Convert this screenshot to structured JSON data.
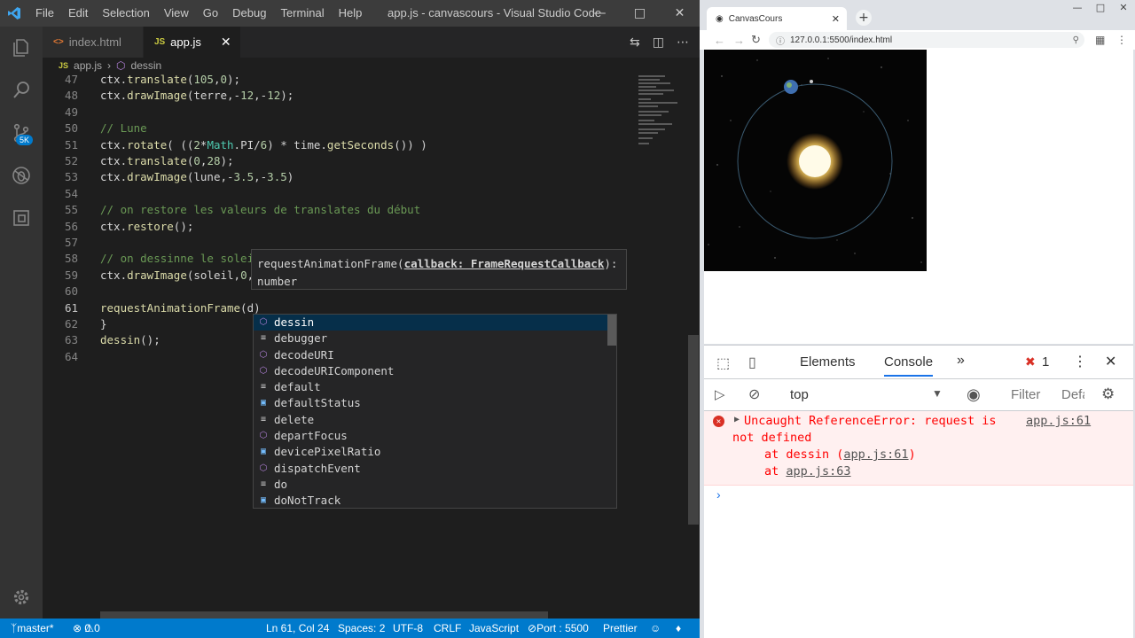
{
  "vscode": {
    "menu": [
      "File",
      "Edit",
      "Selection",
      "View",
      "Go",
      "Debug",
      "Terminal",
      "Help"
    ],
    "window_title": "app.js - canvascours - Visual Studio Code",
    "tabs": [
      {
        "label": "index.html",
        "icon": "<>"
      },
      {
        "label": "app.js",
        "icon": "JS"
      }
    ],
    "breadcrumb": {
      "file": "app.js",
      "symbol": "dessin"
    },
    "activity_badge": "5K",
    "hint": {
      "sig_name": "requestAnimationFrame(",
      "param": "callback: FrameRequestCallback",
      "sig_end": "):",
      "return_type": "number"
    },
    "suggestions": [
      {
        "label": "dessin",
        "kind": "cube"
      },
      {
        "label": "debugger",
        "kind": "kw"
      },
      {
        "label": "decodeURI",
        "kind": "cube"
      },
      {
        "label": "decodeURIComponent",
        "kind": "cube"
      },
      {
        "label": "default",
        "kind": "kw"
      },
      {
        "label": "defaultStatus",
        "kind": "var"
      },
      {
        "label": "delete",
        "kind": "kw"
      },
      {
        "label": "departFocus",
        "kind": "cube"
      },
      {
        "label": "devicePixelRatio",
        "kind": "var"
      },
      {
        "label": "dispatchEvent",
        "kind": "cube"
      },
      {
        "label": "do",
        "kind": "kw"
      },
      {
        "label": "doNotTrack",
        "kind": "var"
      }
    ],
    "status": {
      "branch": "master*",
      "errors": "0",
      "warnings": "0",
      "position": "Ln 61, Col 24",
      "spaces": "Spaces: 2",
      "encoding": "UTF-8",
      "eol": "CRLF",
      "language": "JavaScript",
      "port": "Port : 5500",
      "formatter": "Prettier"
    }
  },
  "code_lines": [
    {
      "n": "47",
      "parts": [
        [
          "",
          "ctx."
        ],
        [
          "fn",
          "translate"
        ],
        [
          "",
          "("
        ],
        [
          "num",
          "105"
        ],
        [
          "",
          ","
        ],
        [
          "num",
          "0"
        ],
        [
          "",
          ");"
        ]
      ]
    },
    {
      "n": "48",
      "parts": [
        [
          "",
          "ctx."
        ],
        [
          "fn",
          "drawImage"
        ],
        [
          "",
          "(terre,-"
        ],
        [
          "num",
          "12"
        ],
        [
          "",
          ",-"
        ],
        [
          "num",
          "12"
        ],
        [
          "",
          ");"
        ]
      ]
    },
    {
      "n": "49",
      "parts": []
    },
    {
      "n": "50",
      "parts": [
        [
          "cmt",
          "// Lune"
        ]
      ]
    },
    {
      "n": "51",
      "parts": [
        [
          "",
          "ctx."
        ],
        [
          "fn",
          "rotate"
        ],
        [
          "",
          "( (("
        ],
        [
          "num",
          "2"
        ],
        [
          "",
          "*"
        ],
        [
          "cls",
          "Math"
        ],
        [
          "",
          ".PI/"
        ],
        [
          "num",
          "6"
        ],
        [
          "",
          ") * time."
        ],
        [
          "fn",
          "getSeconds"
        ],
        [
          "",
          "()) )"
        ]
      ]
    },
    {
      "n": "52",
      "parts": [
        [
          "",
          "ctx."
        ],
        [
          "fn",
          "translate"
        ],
        [
          "",
          "("
        ],
        [
          "num",
          "0"
        ],
        [
          "",
          ","
        ],
        [
          "num",
          "28"
        ],
        [
          "",
          ");"
        ]
      ]
    },
    {
      "n": "53",
      "parts": [
        [
          "",
          "ctx."
        ],
        [
          "fn",
          "drawImage"
        ],
        [
          "",
          "(lune,-"
        ],
        [
          "num",
          "3.5"
        ],
        [
          "",
          ",-"
        ],
        [
          "num",
          "3.5"
        ],
        [
          "",
          ")"
        ]
      ]
    },
    {
      "n": "54",
      "parts": []
    },
    {
      "n": "55",
      "parts": [
        [
          "cmt",
          "// on restore les valeurs de translates du début"
        ]
      ]
    },
    {
      "n": "56",
      "parts": [
        [
          "",
          "ctx."
        ],
        [
          "fn",
          "restore"
        ],
        [
          "",
          "();"
        ]
      ]
    },
    {
      "n": "57",
      "parts": []
    },
    {
      "n": "58",
      "parts": [
        [
          "cmt",
          "// on dessinne le solei"
        ]
      ]
    },
    {
      "n": "59",
      "parts": [
        [
          "",
          "ctx."
        ],
        [
          "fn",
          "drawImage"
        ],
        [
          "",
          "(soleil,"
        ],
        [
          "num",
          "0"
        ],
        [
          "",
          ","
        ]
      ]
    },
    {
      "n": "60",
      "parts": []
    },
    {
      "n": "61",
      "parts": [
        [
          "fn",
          "requestAnimationFrame"
        ],
        [
          "",
          "(d)"
        ]
      ]
    },
    {
      "n": "62",
      "parts": [
        [
          "",
          "}"
        ]
      ]
    },
    {
      "n": "63",
      "parts": [
        [
          "fn",
          "dessin"
        ],
        [
          "",
          "();"
        ]
      ]
    },
    {
      "n": "64",
      "parts": []
    }
  ],
  "browser": {
    "tab_title": "CanvasCours",
    "url": "127.0.0.1:5500/index.html",
    "devtools": {
      "tabs": [
        "Elements",
        "Console"
      ],
      "error_count": "1",
      "context": "top",
      "filter_placeholder": "Filter",
      "levels": "Defa",
      "error": {
        "line1": "Uncaught ReferenceError: request is",
        "line2": "not defined",
        "source": "app.js:61",
        "at1_prefix": "at dessin (",
        "at1_link": "app.js:61",
        "at1_suffix": ")",
        "at2_prefix": "at ",
        "at2_link": "app.js:63"
      }
    }
  },
  "colors": {
    "accent": "#007acc",
    "error": "#ff0000"
  }
}
